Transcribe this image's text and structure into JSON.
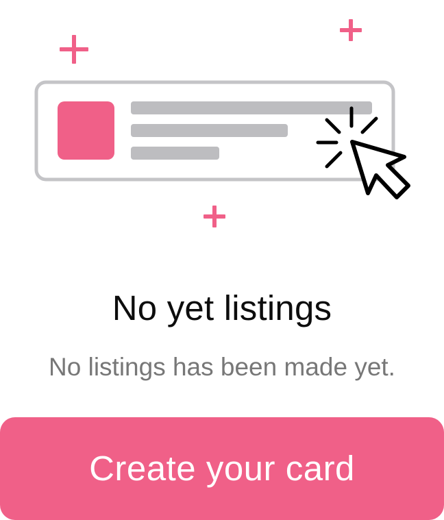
{
  "empty_state": {
    "title": "No yet listings",
    "subtitle": "No listings has been made yet.",
    "button_label": "Create your card"
  },
  "illustration": {
    "icons": [
      "plus-icon",
      "plus-icon",
      "plus-icon",
      "listing-card-placeholder",
      "cursor-click-icon"
    ]
  },
  "colors": {
    "accent": "#f06088",
    "placeholder_gray": "#bdbdc0",
    "card_border": "#c4c4c7",
    "title": "#0d0d0d",
    "subtitle": "#777777",
    "button_text": "#ffffff"
  }
}
